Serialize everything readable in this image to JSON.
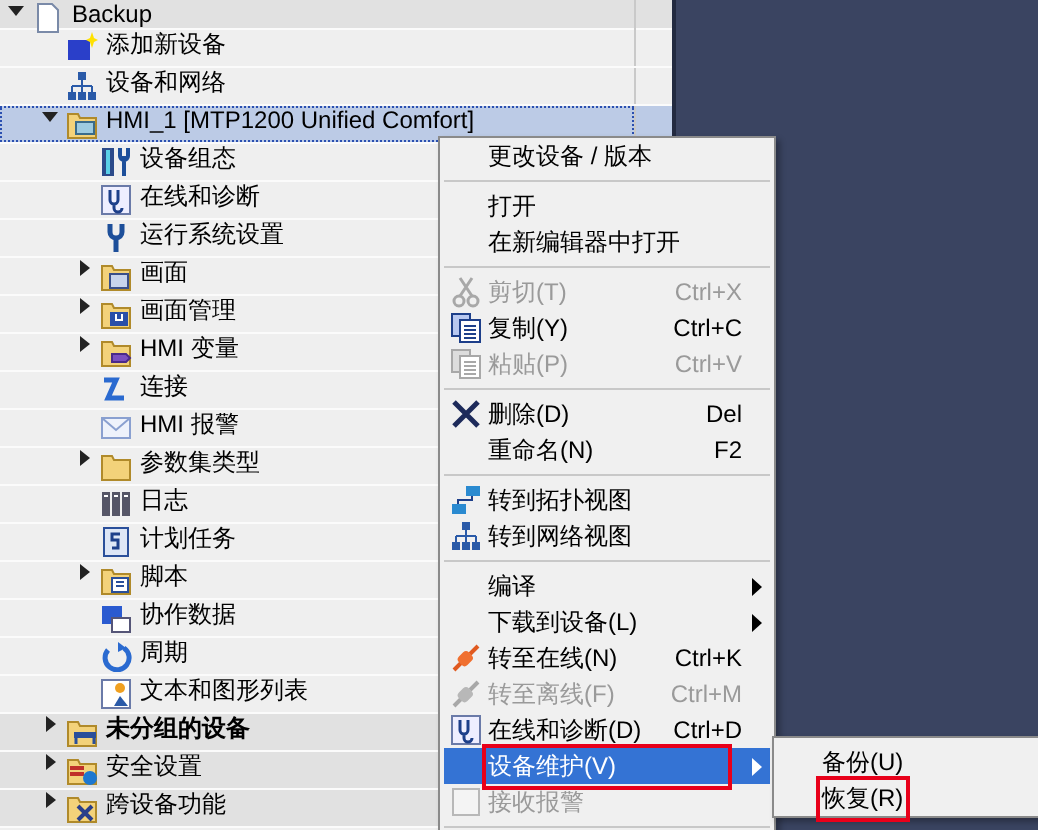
{
  "tree": [
    {
      "label": "Backup",
      "kind": "document",
      "expanded": true,
      "selected": false,
      "children": [
        {
          "label": "添加新设备",
          "kind": "add-device",
          "selected": false
        },
        {
          "label": "设备和网络",
          "kind": "network",
          "selected": false
        },
        {
          "label": "HMI_1 [MTP1200 Unified Comfort]",
          "kind": "device-folder",
          "expanded": true,
          "selected": true,
          "children": [
            {
              "label": "设备组态",
              "kind": "config",
              "selected": false
            },
            {
              "label": "在线和诊断",
              "kind": "diagnostics",
              "selected": false
            },
            {
              "label": "运行系统设置",
              "kind": "wrench",
              "selected": false
            },
            {
              "label": "画面",
              "kind": "screen-folder",
              "expanded": false,
              "selected": false
            },
            {
              "label": "画面管理",
              "kind": "manage-folder",
              "expanded": false,
              "selected": false
            },
            {
              "label": "HMI 变量",
              "kind": "tag-folder",
              "expanded": false,
              "selected": false
            },
            {
              "label": "连接",
              "kind": "connection",
              "selected": false
            },
            {
              "label": "HMI 报警",
              "kind": "mail",
              "selected": false
            },
            {
              "label": "参数集类型",
              "kind": "folder",
              "expanded": false,
              "selected": false
            },
            {
              "label": "日志",
              "kind": "log",
              "selected": false
            },
            {
              "label": "计划任务",
              "kind": "schedule",
              "selected": false
            },
            {
              "label": "脚本",
              "kind": "script-folder",
              "expanded": false,
              "selected": false
            },
            {
              "label": "协作数据",
              "kind": "data",
              "selected": false
            },
            {
              "label": "周期",
              "kind": "cycle",
              "selected": false
            },
            {
              "label": "文本和图形列表",
              "kind": "list",
              "selected": false
            }
          ]
        },
        {
          "label": "未分组的设备",
          "kind": "group-folder",
          "expanded": false,
          "selected": false,
          "bold": true
        },
        {
          "label": "安全设置",
          "kind": "security-folder",
          "expanded": false,
          "selected": false
        },
        {
          "label": "跨设备功能",
          "kind": "cross-folder",
          "expanded": false,
          "selected": false
        }
      ]
    }
  ],
  "context_menu": [
    {
      "kind": "plain",
      "label": "更改设备 / 版本",
      "disabled": false,
      "selected": false
    },
    {
      "kind": "separator"
    },
    {
      "kind": "plain",
      "label": "打开",
      "disabled": false,
      "selected": false
    },
    {
      "kind": "plain",
      "label": "在新编辑器中打开",
      "disabled": false,
      "selected": false
    },
    {
      "kind": "separator"
    },
    {
      "kind": "cut",
      "label": "剪切(T)",
      "shortcut": "Ctrl+X",
      "disabled": true,
      "selected": false
    },
    {
      "kind": "copy",
      "label": "复制(Y)",
      "shortcut": "Ctrl+C",
      "disabled": false,
      "selected": false
    },
    {
      "kind": "paste",
      "label": "粘贴(P)",
      "shortcut": "Ctrl+V",
      "disabled": true,
      "selected": false
    },
    {
      "kind": "separator"
    },
    {
      "kind": "delete",
      "label": "删除(D)",
      "shortcut": "Del",
      "disabled": false,
      "selected": false
    },
    {
      "kind": "plain",
      "label": "重命名(N)",
      "shortcut": "F2",
      "disabled": false,
      "selected": false
    },
    {
      "kind": "separator"
    },
    {
      "kind": "topology",
      "label": "转到拓扑视图",
      "disabled": false,
      "selected": false
    },
    {
      "kind": "network",
      "label": "转到网络视图",
      "disabled": false,
      "selected": false
    },
    {
      "kind": "separator"
    },
    {
      "kind": "plain",
      "label": "编译",
      "submenu": true,
      "disabled": false,
      "selected": false
    },
    {
      "kind": "plain",
      "label": "下载到设备(L)",
      "submenu": true,
      "disabled": false,
      "selected": false
    },
    {
      "kind": "online",
      "label": "转至在线(N)",
      "shortcut": "Ctrl+K",
      "disabled": false,
      "selected": false
    },
    {
      "kind": "offline",
      "label": "转至离线(F)",
      "shortcut": "Ctrl+M",
      "disabled": true,
      "selected": false
    },
    {
      "kind": "diagnostics",
      "label": "在线和诊断(D)",
      "shortcut": "Ctrl+D",
      "disabled": false,
      "selected": false
    },
    {
      "kind": "plain",
      "label": "设备维护(V)",
      "submenu": true,
      "disabled": false,
      "selected": true,
      "marked": true
    },
    {
      "kind": "checkbox",
      "label": "接收报警",
      "disabled": true,
      "selected": false
    },
    {
      "kind": "separator"
    }
  ],
  "submenu": [
    {
      "label": "备份(U)",
      "selected": false,
      "marked": false
    },
    {
      "label": "恢复(R)",
      "selected": false,
      "marked": true
    }
  ]
}
